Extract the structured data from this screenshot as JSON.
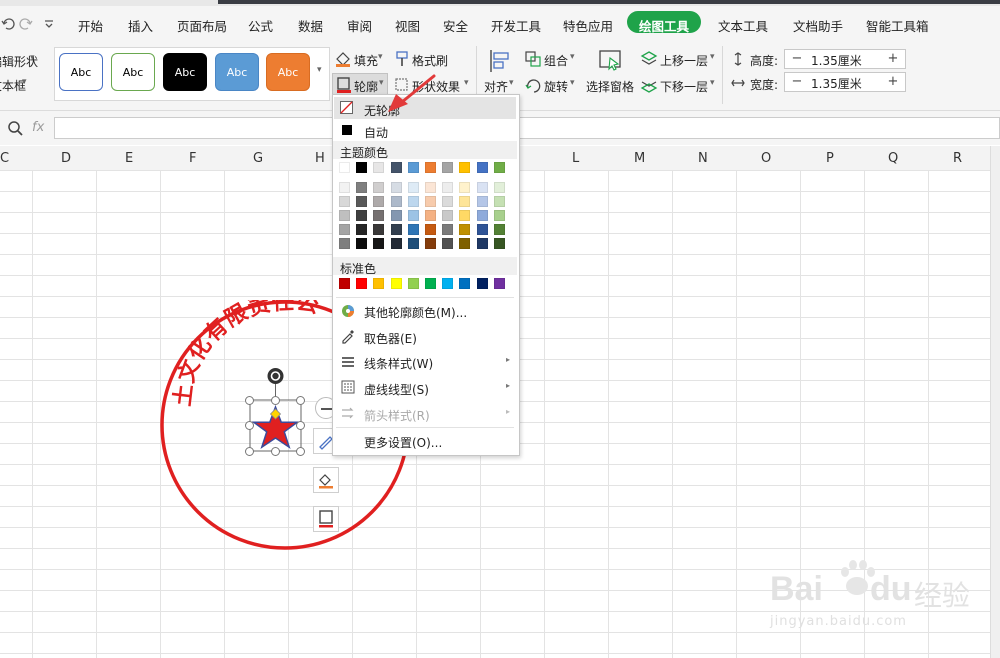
{
  "title_bar": {
    "quick_access_icons": [
      "undo-icon",
      "redo-icon",
      "customize-icon"
    ]
  },
  "menu": {
    "tabs": [
      {
        "label": "开始"
      },
      {
        "label": "插入"
      },
      {
        "label": "页面布局"
      },
      {
        "label": "公式"
      },
      {
        "label": "数据"
      },
      {
        "label": "审阅"
      },
      {
        "label": "视图"
      },
      {
        "label": "安全"
      },
      {
        "label": "开发工具"
      },
      {
        "label": "特色应用"
      },
      {
        "label": "绘图工具"
      },
      {
        "label": "文本工具"
      },
      {
        "label": "文档助手"
      },
      {
        "label": "智能工具箱"
      }
    ],
    "active_tab": "绘图工具",
    "active_color": "#1fa34a"
  },
  "ribbon": {
    "edit_shape": "编辑形状",
    "text_box": "文本框",
    "shape_styles": [
      {
        "label": "Abc",
        "fill": "#ffffff",
        "border": "#4a72c4",
        "text": "#000000"
      },
      {
        "label": "Abc",
        "fill": "#ffffff",
        "border": "#6aa84f",
        "text": "#000000"
      },
      {
        "label": "Abc",
        "fill": "#000000",
        "border": "#000000",
        "text": "#ffffff"
      },
      {
        "label": "Abc",
        "fill": "#5b9bd5",
        "border": "#4a86c5",
        "text": "#ffffff"
      },
      {
        "label": "Abc",
        "fill": "#ed7d31",
        "border": "#d86c22",
        "text": "#ffffff"
      }
    ],
    "fill": "填充",
    "format_painter": "格式刷",
    "outline": "轮廓",
    "shape_effects": "形状效果",
    "align": "对齐",
    "group": "组合",
    "rotate": "旋转",
    "selection_pane": "选择窗格",
    "bring_forward": "上移一层",
    "send_backward": "下移一层",
    "height_label": "高度:",
    "height_value": "1.35厘米",
    "width_label": "宽度:",
    "width_value": "1.35厘米"
  },
  "formula_bar": {
    "fx": "fx",
    "value": ""
  },
  "columns": [
    "C",
    "D",
    "E",
    "F",
    "G",
    "H",
    "L",
    "M",
    "N",
    "O",
    "P",
    "Q",
    "R"
  ],
  "stamp": {
    "text": "土文化有限责任公",
    "color": "#e02020",
    "star_fill": "#e02020",
    "star_stroke": "#3b4a9a"
  },
  "outline_menu": {
    "no_outline": "无轮廓",
    "auto": "自动",
    "theme_colors_header": "主题颜色",
    "theme_colors": [
      "#ffffff",
      "#000000",
      "#e7e6e6",
      "#44546a",
      "#5b9bd5",
      "#ed7d31",
      "#a5a5a5",
      "#ffc000",
      "#4472c4",
      "#70ad47"
    ],
    "theme_shades": [
      [
        "#f2f2f2",
        "#7f7f7f",
        "#d0cece",
        "#d6dce4",
        "#deebf6",
        "#fbe5d5",
        "#ededed",
        "#fff2cc",
        "#d9e2f3",
        "#e2efd9"
      ],
      [
        "#d8d8d8",
        "#595959",
        "#aeaaaa",
        "#adb9ca",
        "#bdd7ee",
        "#f7cbac",
        "#dbdbdb",
        "#fee599",
        "#b4c6e7",
        "#c5e0b3"
      ],
      [
        "#bfbfbf",
        "#3f3f3f",
        "#757070",
        "#8497b0",
        "#9cc3e5",
        "#f4b183",
        "#c9c9c9",
        "#ffd965",
        "#8eaadb",
        "#a8d08d"
      ],
      [
        "#a5a5a5",
        "#262626",
        "#3a3838",
        "#323f4f",
        "#2e75b5",
        "#c55a11",
        "#7b7b7b",
        "#bf9000",
        "#2f5496",
        "#538135"
      ],
      [
        "#7f7f7f",
        "#0c0c0c",
        "#171616",
        "#222a35",
        "#1e4e79",
        "#843c0b",
        "#525252",
        "#7f6000",
        "#1f3864",
        "#375623"
      ]
    ],
    "standard_colors_header": "标准色",
    "standard_colors": [
      "#c00000",
      "#ff0000",
      "#ffc000",
      "#ffff00",
      "#92d050",
      "#00b050",
      "#00b0f0",
      "#0070c0",
      "#002060",
      "#7030a0"
    ],
    "more_colors": "其他轮廓颜色(M)...",
    "eyedropper": "取色器(E)",
    "line_style": "线条样式(W)",
    "dash_style": "虚线线型(S)",
    "arrow_style": "箭头样式(R)",
    "more_settings": "更多设置(O)..."
  },
  "watermark": {
    "logo": "Bai",
    "logo2": "du",
    "brand": "经验",
    "url": "jingyan.baidu.com"
  }
}
